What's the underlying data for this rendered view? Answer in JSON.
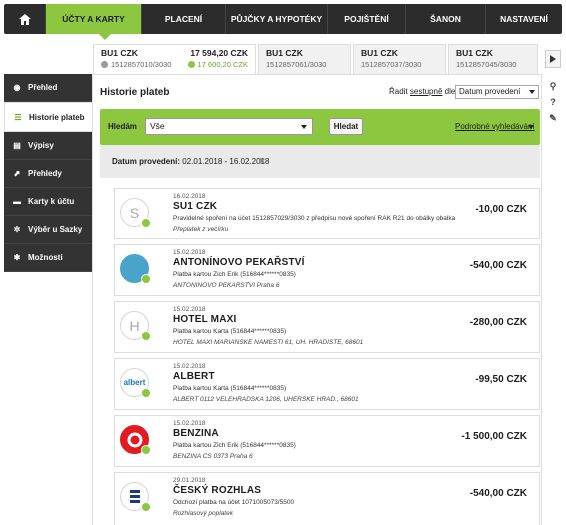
{
  "topnav": {
    "items": [
      {
        "label": "ÚČTY A KARTY",
        "active": true
      },
      {
        "label": "PLACENÍ"
      },
      {
        "label": "PŮJČKY A HYPOTÉKY"
      },
      {
        "label": "POJIŠTĚNÍ"
      },
      {
        "label": "ŠANON"
      },
      {
        "label": "NASTAVENÍ"
      }
    ]
  },
  "accounts": [
    {
      "name": "BU1 CZK",
      "number": "1512857010/3030",
      "balance": "17 594,20 CZK",
      "available": "17 600,20 CZK"
    },
    {
      "name": "BU1 CZK",
      "number": "1512857061/3030"
    },
    {
      "name": "BU1 CZK",
      "number": "1512857037/3030"
    },
    {
      "name": "BU1 CZK",
      "number": "1512857045/3030"
    }
  ],
  "sidebar": {
    "items": [
      {
        "label": "Přehled",
        "icon": "eye-icon"
      },
      {
        "label": "Historie plateb",
        "icon": "list-icon",
        "active": true
      },
      {
        "label": "Výpisy",
        "icon": "document-icon"
      },
      {
        "label": "Přehledy",
        "icon": "chart-icon"
      },
      {
        "label": "Karty k účtu",
        "icon": "card-icon"
      },
      {
        "label": "Výběr u Sazky",
        "icon": "gear-icon"
      },
      {
        "label": "Možnosti",
        "icon": "settings-icon"
      }
    ]
  },
  "main": {
    "title": "Historie plateb",
    "sort_prefix": "Řadit",
    "sort_dir": "sestupně",
    "sort_suffix": "dle:",
    "sort_value": "Datum provedení"
  },
  "filter": {
    "label": "Hledám",
    "value": "Vše",
    "button": "Hledat",
    "advanced": "Podrobné vyhledávání"
  },
  "date_filter": {
    "label": "Datum provedení:",
    "value": "02.01.2018 - 16.02.2018"
  },
  "transactions": [
    {
      "date": "16.02.2018",
      "name": "SU1 CZK",
      "desc": "Pravidelné spoření na účet 1512857029/3030 z předpisu nové spoření RAK R21 do obálky obalka",
      "note": "Přeplatek z večírku",
      "amount": "-10,00 CZK",
      "logo": "S"
    },
    {
      "date": "15.02.2018",
      "name": "ANTONÍNOVO PEKAŘSTVÍ",
      "desc": "Platba kartou Zich Erik (516844******0835)",
      "note": "ANTONINOVO PEKARSTVI Praha 6",
      "amount": "-540,00 CZK",
      "logo": ""
    },
    {
      "date": "15.02.2018",
      "name": "HOTEL MAXI",
      "desc": "Platba kartou Karta (516844******0835)",
      "note": "HOTEL MAXI MARIANSKE NAMESTI 61, UH. HRADISTE, 68601",
      "amount": "-280,00 CZK",
      "logo": "H"
    },
    {
      "date": "15.02.2018",
      "name": "ALBERT",
      "desc": "Platba kartou Karta (516844******0835)",
      "note": "ALBERT 0112 VELEHRADSKA 1206, UHERSKE HRAD., 68601",
      "amount": "-99,50 CZK",
      "logo": "albert"
    },
    {
      "date": "15.02.2018",
      "name": "BENZINA",
      "desc": "Platba kartou Zich Erik (516844******0835)",
      "note": "BENZINA CS 0373 Praha 6",
      "amount": "-1 500,00 CZK",
      "logo": ""
    },
    {
      "date": "29.01.2018",
      "name": "ČESKÝ ROZHLAS",
      "desc": "Odchozí platba na účet 1071005073/5500",
      "note": "Rozhlasový poplatek",
      "amount": "-540,00 CZK",
      "logo": ""
    }
  ],
  "colors": {
    "accent": "#8dc63f",
    "dark": "#2c2c2c"
  }
}
